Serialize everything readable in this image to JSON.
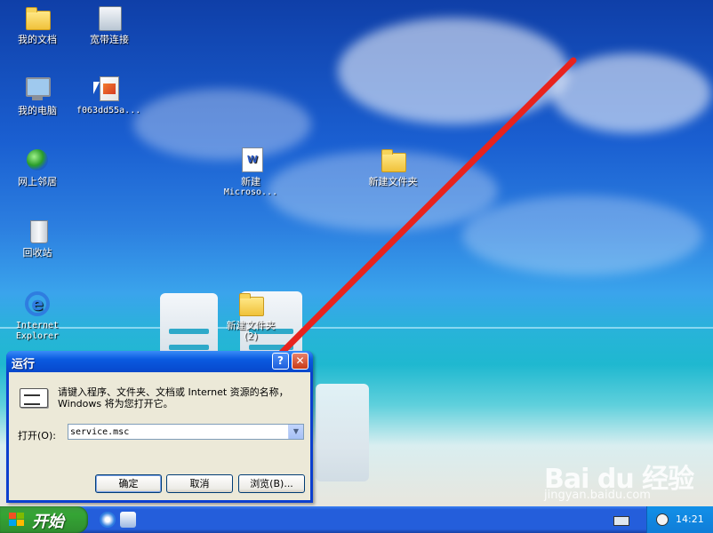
{
  "desktop": {
    "icons": [
      {
        "label": "我的文档",
        "icon": "folder-icon"
      },
      {
        "label": "宽带连接",
        "icon": "network-connection-icon"
      },
      {
        "label": "我的电脑",
        "icon": "computer-icon"
      },
      {
        "label": "f063dd55a...",
        "icon": "image-file-icon"
      },
      {
        "label": "网上邻居",
        "icon": "network-places-icon"
      },
      {
        "label": "新建",
        "label2": "Microso...",
        "icon": "word-document-icon"
      },
      {
        "label": "新建文件夹",
        "icon": "folder-icon"
      },
      {
        "label": "回收站",
        "icon": "recycle-bin-icon"
      },
      {
        "label": "Internet",
        "label2": "Explorer",
        "icon": "internet-explorer-icon"
      },
      {
        "label": "新建文件夹",
        "label2": "(2)",
        "icon": "folder-icon"
      }
    ]
  },
  "run_dialog": {
    "title": "运行",
    "help_glyph": "?",
    "close_glyph": "✕",
    "description": "请键入程序、文件夹、文档或 Internet 资源的名称，Windows 将为您打开它。",
    "open_label": "打开(O):",
    "open_value": "service.msc",
    "ok_label": "确定",
    "cancel_label": "取消",
    "browse_label": "浏览(B)..."
  },
  "taskbar": {
    "start_label": "开始",
    "clock": "14:21"
  },
  "watermark": {
    "logo": "Bai du 经验",
    "site": "jingyan.baidu.com"
  },
  "colors": {
    "arrow": "#e8231d",
    "titlebar": "#0a5ae0",
    "taskbar": "#245edb",
    "start_button": "#35a535"
  }
}
